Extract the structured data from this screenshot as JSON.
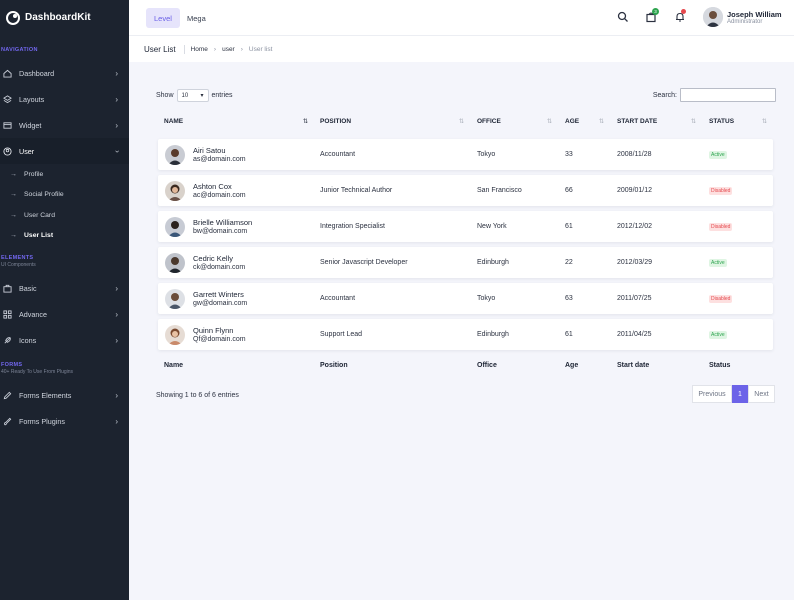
{
  "brand": {
    "name": "DashboardKit"
  },
  "topbar": {
    "tabs": [
      "Level",
      "Mega"
    ],
    "cart_badge": "3",
    "user": {
      "name": "Joseph William",
      "role": "Administrator"
    }
  },
  "sidebar": {
    "sections": {
      "navigation": {
        "title": "NAVIGATION"
      },
      "elements": {
        "title": "ELEMENTS",
        "subtitle": "UI Components"
      },
      "forms": {
        "title": "FORMS",
        "subtitle": "40+ Ready To Use From Plugins"
      }
    },
    "items": {
      "dashboard": "Dashboard",
      "layouts": "Layouts",
      "widget": "Widget",
      "user": "User",
      "basic": "Basic",
      "advance": "Advance",
      "icons": "Icons",
      "forms_elements": "Forms Elements",
      "forms_plugins": "Forms Plugins"
    },
    "user_submenu": [
      "Profile",
      "Social Profile",
      "User Card",
      "User List"
    ]
  },
  "breadcrumb": {
    "title": "User List",
    "items": [
      "Home",
      "user",
      "User list"
    ]
  },
  "table": {
    "show_label": "Show",
    "entries_value": "10",
    "entries_label": "entries",
    "search_label": "Search:",
    "headers": [
      "NAME",
      "POSITION",
      "OFFICE",
      "AGE",
      "START DATE",
      "STATUS"
    ],
    "footers": [
      "Name",
      "Position",
      "Office",
      "Age",
      "Start date",
      "Status"
    ],
    "rows": [
      {
        "name": "Airi Satou",
        "email": "as@domain.com",
        "position": "Accountant",
        "office": "Tokyo",
        "age": "33",
        "start": "2008/11/28",
        "status": "Active"
      },
      {
        "name": "Ashton Cox",
        "email": "ac@domain.com",
        "position": "Junior Technical Author",
        "office": "San Francisco",
        "age": "66",
        "start": "2009/01/12",
        "status": "Disabled"
      },
      {
        "name": "Brielle Williamson",
        "email": "bw@domain.com",
        "position": "Integration Specialist",
        "office": "New York",
        "age": "61",
        "start": "2012/12/02",
        "status": "Disabled"
      },
      {
        "name": "Cedric Kelly",
        "email": "ck@domain.com",
        "position": "Senior Javascript Developer",
        "office": "Edinburgh",
        "age": "22",
        "start": "2012/03/29",
        "status": "Active"
      },
      {
        "name": "Garrett Winters",
        "email": "gw@domain.com",
        "position": "Accountant",
        "office": "Tokyo",
        "age": "63",
        "start": "2011/07/25",
        "status": "Disabled"
      },
      {
        "name": "Quinn Flynn",
        "email": "Qf@domain.com",
        "position": "Support Lead",
        "office": "Edinburgh",
        "age": "61",
        "start": "2011/04/25",
        "status": "Active"
      }
    ],
    "info": "Showing 1 to 6 of 6 entries",
    "pagination": {
      "previous": "Previous",
      "current": "1",
      "next": "Next"
    }
  },
  "colors": {
    "accent": "#6c63e8",
    "sidebar_bg": "#1c232f",
    "active": "#2ea44f",
    "disabled": "#e5484d"
  }
}
